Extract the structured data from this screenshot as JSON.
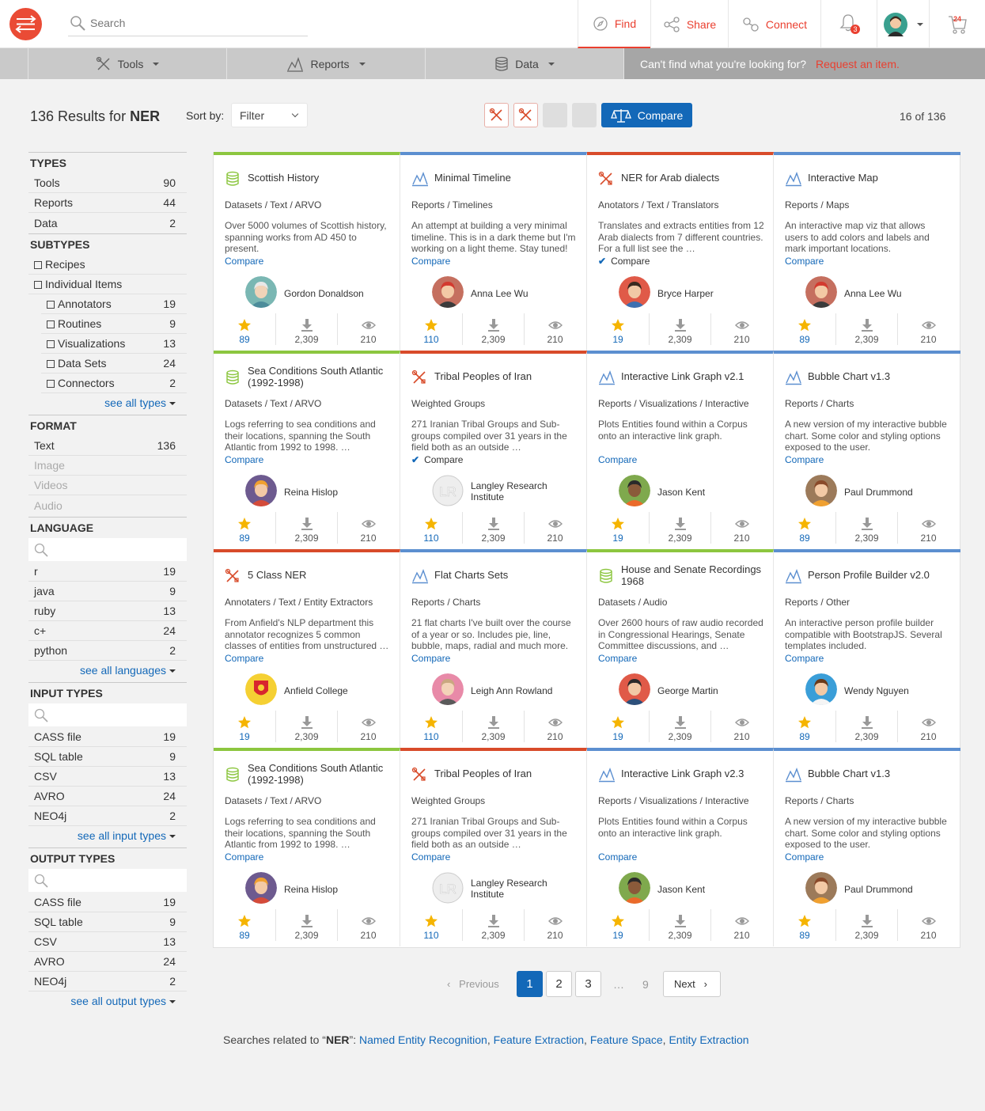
{
  "header": {
    "search_placeholder": "Search",
    "nav": {
      "find": "Find",
      "share": "Share",
      "connect": "Connect"
    },
    "notifications_count": "3",
    "cart_count": "24"
  },
  "subnav": {
    "tools": "Tools",
    "reports": "Reports",
    "data": "Data",
    "cta_text": "Can't find what you're looking for?",
    "cta_link": "Request an item."
  },
  "results": {
    "count_text": "136 Results for",
    "query": "NER",
    "sort_label": "Sort by:",
    "sort_value": "Filter",
    "compare_label": "Compare",
    "page_count": "16 of 136"
  },
  "sidebar": {
    "types": {
      "title": "TYPES",
      "items": [
        {
          "label": "Tools",
          "count": "90"
        },
        {
          "label": "Reports",
          "count": "44"
        },
        {
          "label": "Data",
          "count": "2"
        }
      ]
    },
    "subtypes": {
      "title": "SUBTYPES",
      "top": [
        "Recipes",
        "Individual Items"
      ],
      "items": [
        {
          "label": "Annotators",
          "count": "19"
        },
        {
          "label": "Routines",
          "count": "9"
        },
        {
          "label": "Visualizations",
          "count": "13"
        },
        {
          "label": "Data Sets",
          "count": "24"
        },
        {
          "label": "Connectors",
          "count": "2"
        }
      ],
      "see_all": "see all types"
    },
    "format": {
      "title": "FORMAT",
      "items": [
        {
          "label": "Text",
          "count": "136"
        },
        {
          "label": "Image",
          "count": ""
        },
        {
          "label": "Videos",
          "count": ""
        },
        {
          "label": "Audio",
          "count": ""
        }
      ]
    },
    "language": {
      "title": "LANGUAGE",
      "items": [
        {
          "label": "r",
          "count": "19"
        },
        {
          "label": "java",
          "count": "9"
        },
        {
          "label": "ruby",
          "count": "13"
        },
        {
          "label": "c+",
          "count": "24"
        },
        {
          "label": "python",
          "count": "2"
        }
      ],
      "see_all": "see all languages"
    },
    "input_types": {
      "title": "INPUT TYPES",
      "items": [
        {
          "label": "CASS file",
          "count": "19"
        },
        {
          "label": "SQL table",
          "count": "9"
        },
        {
          "label": "CSV",
          "count": "13"
        },
        {
          "label": "AVRO",
          "count": "24"
        },
        {
          "label": "NEO4j",
          "count": "2"
        }
      ],
      "see_all": "see all input types"
    },
    "output_types": {
      "title": "OUTPUT TYPES",
      "items": [
        {
          "label": "CASS file",
          "count": "19"
        },
        {
          "label": "SQL table",
          "count": "9"
        },
        {
          "label": "CSV",
          "count": "13"
        },
        {
          "label": "AVRO",
          "count": "24"
        },
        {
          "label": "NEO4j",
          "count": "2"
        }
      ],
      "see_all": "see all output types"
    }
  },
  "cards": [
    {
      "kind": "data",
      "title": "Scottish History",
      "sub": "Datasets / Text / ARVO",
      "desc": "Over 5000 volumes of Scottish history, spanning works from AD 450 to present.",
      "compare": "Compare",
      "checked": false,
      "author": "Gordon Donaldson",
      "avatar": "gordon",
      "stars": "89",
      "downloads": "2,309",
      "views": "210"
    },
    {
      "kind": "report",
      "title": "Minimal Timeline",
      "sub": "Reports / Timelines",
      "desc": "An attempt at building a very minimal timeline. This is in a dark theme but I'm working on a light theme. Stay tuned!",
      "compare": "Compare",
      "checked": false,
      "author": "Anna Lee Wu",
      "avatar": "anna",
      "stars": "110",
      "downloads": "2,309",
      "views": "210"
    },
    {
      "kind": "tool",
      "title": "NER for Arab dialects",
      "sub": "Anotators / Text / Translators",
      "desc": "Translates and extracts entities from 12 Arab dialects from 7 different countries. For a full list see the  …",
      "compare": "Compare",
      "checked": true,
      "author": "Bryce Harper",
      "avatar": "bryce",
      "stars": "19",
      "downloads": "2,309",
      "views": "210"
    },
    {
      "kind": "report",
      "title": "Interactive Map",
      "sub": "Reports / Maps",
      "desc": "An interactive map viz that allows users to add colors and labels and mark important locations.",
      "compare": "Compare",
      "checked": false,
      "author": "Anna Lee Wu",
      "avatar": "anna",
      "stars": "89",
      "downloads": "2,309",
      "views": "210"
    },
    {
      "kind": "data",
      "title": "Sea Conditions South Atlantic (1992-1998)",
      "sub": "Datasets / Text / ARVO",
      "desc": "Logs referring to sea conditions and their locations, spanning the South Atlantic from 1992 to 1998.  …",
      "compare": "Compare",
      "checked": false,
      "author": "Reina Hislop",
      "avatar": "reina",
      "stars": "89",
      "downloads": "2,309",
      "views": "210"
    },
    {
      "kind": "tool",
      "title": "Tribal Peoples of Iran",
      "sub": "Weighted Groups",
      "desc": "271 Iranian Tribal Groups and Sub-groups compiled over 31 years in the field both as an outside  …",
      "compare": "Compare",
      "checked": true,
      "author": "Langley Research Institute",
      "avatar": "lr",
      "stars": "110",
      "downloads": "2,309",
      "views": "210"
    },
    {
      "kind": "report",
      "title": "Interactive Link Graph v2.1",
      "sub": "Reports / Visualizations / Interactive",
      "desc": "Plots Entities found within a Corpus onto an interactive link graph.",
      "compare": "Compare",
      "checked": false,
      "author": "Jason Kent",
      "avatar": "jason",
      "stars": "19",
      "downloads": "2,309",
      "views": "210"
    },
    {
      "kind": "report",
      "title": "Bubble Chart v1.3",
      "sub": "Reports / Charts",
      "desc": "A new version of my interactive bubble chart. Some color and styling options exposed to the user.",
      "compare": "Compare",
      "checked": false,
      "author": "Paul Drummond",
      "avatar": "paul",
      "stars": "89",
      "downloads": "2,309",
      "views": "210"
    },
    {
      "kind": "tool",
      "title": "5 Class NER",
      "sub": "Annotaters / Text / Entity Extractors",
      "desc": "From Anfield's NLP department this annotator recognizes 5 common classes of entities from unstructured  …",
      "compare": "Compare",
      "checked": false,
      "author": "Anfield College",
      "avatar": "anfield",
      "stars": "19",
      "downloads": "2,309",
      "views": "210"
    },
    {
      "kind": "report",
      "title": "Flat Charts Sets",
      "sub": "Reports / Charts",
      "desc": "21 flat charts I've built over the course of a year or so. Includes pie, line, bubble, maps, radial and much more.",
      "compare": "Compare",
      "checked": false,
      "author": "Leigh Ann Rowland",
      "avatar": "leigh",
      "stars": "110",
      "downloads": "2,309",
      "views": "210"
    },
    {
      "kind": "data",
      "title": "House and Senate Recordings 1968",
      "sub": "Datasets / Audio",
      "desc": "Over 2600 hours of raw audio recorded in Congressional Hearings, Senate Committee discussions, and  …",
      "compare": "Compare",
      "checked": false,
      "author": "George Martin",
      "avatar": "george",
      "stars": "19",
      "downloads": "2,309",
      "views": "210"
    },
    {
      "kind": "report",
      "title": "Person Profile Builder v2.0",
      "sub": "Reports / Other",
      "desc": "An interactive person profile builder compatible with BootstrapJS. Several templates included.",
      "compare": "Compare",
      "checked": false,
      "author": "Wendy Nguyen",
      "avatar": "wendy",
      "stars": "89",
      "downloads": "2,309",
      "views": "210"
    },
    {
      "kind": "data",
      "title": "Sea Conditions South Atlantic (1992-1998)",
      "sub": "Datasets / Text / ARVO",
      "desc": "Logs referring to sea conditions and their locations, spanning the South Atlantic from 1992 to 1998.  …",
      "compare": "Compare",
      "checked": false,
      "author": "Reina Hislop",
      "avatar": "reina",
      "stars": "89",
      "downloads": "2,309",
      "views": "210"
    },
    {
      "kind": "tool",
      "title": "Tribal Peoples of Iran",
      "sub": "Weighted Groups",
      "desc": "271 Iranian Tribal Groups and Sub-groups compiled over 31 years in the field both as an outside  …",
      "compare": "Compare",
      "checked": false,
      "author": "Langley Research Institute",
      "avatar": "lr",
      "stars": "110",
      "downloads": "2,309",
      "views": "210"
    },
    {
      "kind": "report",
      "title": "Interactive Link Graph v2.3",
      "sub": "Reports / Visualizations / Interactive",
      "desc": "Plots Entities found within a Corpus onto an interactive link graph.",
      "compare": "Compare",
      "checked": false,
      "author": "Jason Kent",
      "avatar": "jason",
      "stars": "19",
      "downloads": "2,309",
      "views": "210"
    },
    {
      "kind": "report",
      "title": "Bubble Chart v1.3",
      "sub": "Reports / Charts",
      "desc": "A new version of my interactive bubble chart. Some color and styling options exposed to the user.",
      "compare": "Compare",
      "checked": false,
      "author": "Paul Drummond",
      "avatar": "paul",
      "stars": "89",
      "downloads": "2,309",
      "views": "210"
    }
  ],
  "pagination": {
    "previous": "Previous",
    "pages": [
      "1",
      "2",
      "3"
    ],
    "ellipsis": "…",
    "last": "9",
    "next": "Next"
  },
  "related": {
    "prefix": "Searches related to “",
    "query": "NER",
    "suffix": "”:",
    "links": [
      "Named Entity Recognition",
      "Feature Extraction",
      "Feature Space",
      "Entity Extraction"
    ]
  },
  "colors": {
    "accent": "#ea3f2f",
    "primary": "#1368b8",
    "data": "#8cc63f",
    "report": "#5c8fd0",
    "tool": "#d84b2a"
  }
}
